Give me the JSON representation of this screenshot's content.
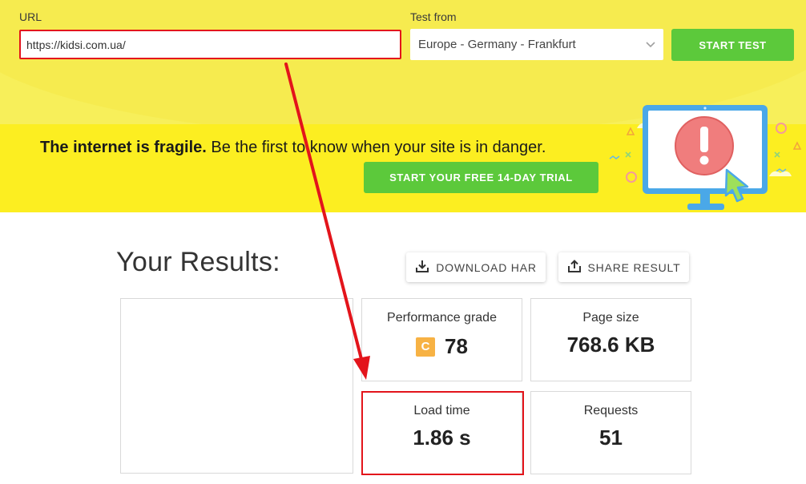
{
  "form": {
    "url_label": "URL",
    "url_value": "https://kidsi.com.ua/",
    "location_label": "Test from",
    "location_value": "Europe - Germany - Frankfurt",
    "start_button": "START TEST"
  },
  "promo": {
    "headline_bold": "The internet is fragile.",
    "headline_rest": " Be the first to know when your site is in danger.",
    "trial_button": "START YOUR FREE 14-DAY TRIAL"
  },
  "results": {
    "title": "Your Results:",
    "download_har": "DOWNLOAD HAR",
    "share_result": "SHARE RESULT",
    "performance": {
      "label": "Performance grade",
      "grade": "C",
      "score": "78"
    },
    "page_size": {
      "label": "Page size",
      "value": "768.6 KB"
    },
    "load_time": {
      "label": "Load time",
      "value": "1.86 s"
    },
    "requests": {
      "label": "Requests",
      "value": "51"
    }
  },
  "colors": {
    "accent_green": "#5cc93b",
    "promo_yellow": "#fcee21",
    "highlight_red": "#e3141b",
    "grade_orange": "#f7b244"
  },
  "icons": [
    "chevron-down-icon",
    "download-icon",
    "share-icon",
    "monitor-alert-illustration"
  ]
}
